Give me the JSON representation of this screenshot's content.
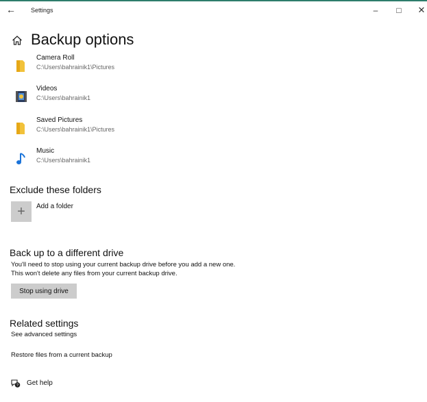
{
  "window": {
    "title": "Settings",
    "back_icon": "←",
    "minimize_icon": "–",
    "maximize_icon": "□",
    "close_icon": "✕"
  },
  "page": {
    "title": "Backup options",
    "home_icon": "home-icon"
  },
  "folders": [
    {
      "name": "Camera Roll",
      "path": "C:\\Users\\bahrainik1\\Pictures",
      "icon": "folder-icon"
    },
    {
      "name": "Videos",
      "path": "C:\\Users\\bahrainik1",
      "icon": "videos-icon"
    },
    {
      "name": "Saved Pictures",
      "path": "C:\\Users\\bahrainik1\\Pictures",
      "icon": "folder-icon"
    },
    {
      "name": "Music",
      "path": "C:\\Users\\bahrainik1",
      "icon": "music-icon"
    }
  ],
  "exclude": {
    "heading": "Exclude these folders",
    "add_label": "Add a folder",
    "add_icon": "+"
  },
  "drive": {
    "heading": "Back up to a different drive",
    "description": "You'll need to stop using your current backup drive before you add a new one. This won't delete any files from your current backup drive.",
    "button_label": "Stop using drive"
  },
  "related": {
    "heading": "Related settings",
    "advanced_link": "See advanced settings",
    "restore_link": "Restore files from a current backup"
  },
  "help": {
    "label": "Get help"
  },
  "colors": {
    "accent_line": "#2e7d6b",
    "folder_yellow": "#f2c23a",
    "music_blue": "#1a73d9",
    "button_gray": "#cccccc"
  }
}
